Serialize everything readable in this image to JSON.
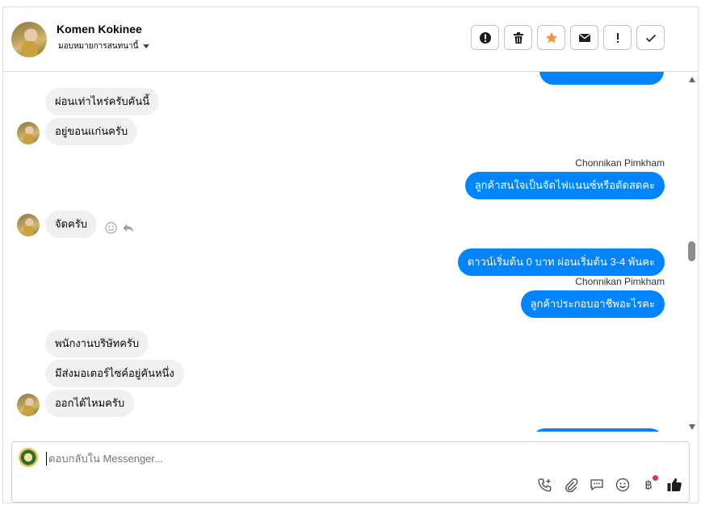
{
  "header": {
    "contact_name": "Komen Kokinee",
    "assign_label": "มอบหมายการสนทนานี้",
    "actions": [
      {
        "icon": "alert-icon",
        "name": "mark-spam-button"
      },
      {
        "icon": "trash-icon",
        "name": "delete-button"
      },
      {
        "icon": "star-icon",
        "name": "star-button"
      },
      {
        "icon": "envelope-icon",
        "name": "mark-unread-button"
      },
      {
        "icon": "exclamation-icon",
        "name": "follow-up-button"
      },
      {
        "icon": "check-icon",
        "name": "mark-done-button"
      }
    ]
  },
  "messages": {
    "m1": "ผ่อนเท่าไหร่ครับคันนี้",
    "m2": "อยู่ขอนแก่นครับ",
    "s1": "Chonnikan Pimkham",
    "m3": "ลูกค้าสนใจเป็นจัดไฟแนนซ์หรือตัดสดคะ",
    "m4": "จัดครับ",
    "m5": "ดาวน์เริ่มต้น 0 บาท ผ่อนเริ่มต้น 3-4 พันคะ",
    "s2": "Chonnikan Pimkham",
    "m6": "ลูกค้าประกอบอาชีพอะไรคะ",
    "m7": "พนักงานบริษัทครับ",
    "m8": "มีส่งมอเตอร์ไซค์อยู่คันหนึ่ง",
    "m9": "ออกได้ไหมครับ"
  },
  "composer": {
    "placeholder": "ตอบกลับใน Messenger...",
    "tools": [
      "call-add-icon",
      "paperclip-icon",
      "saved-reply-icon",
      "emoji-icon",
      "baht-icon",
      "thumbs-up-icon"
    ]
  },
  "colors": {
    "outgoing": "#0084ff",
    "incoming": "#f0f0f0",
    "star": "#f7923a"
  }
}
